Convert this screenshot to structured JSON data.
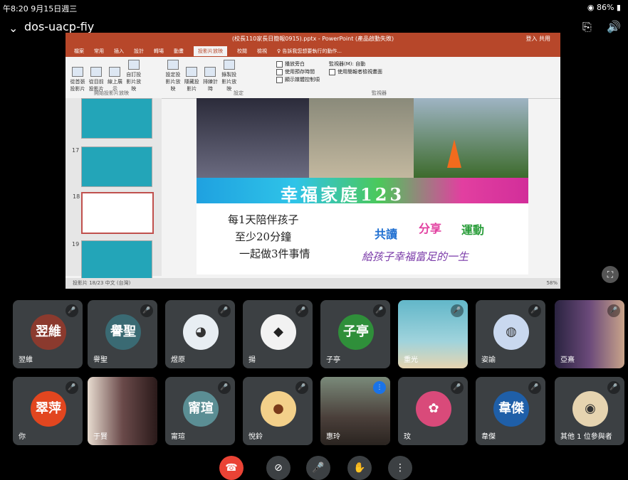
{
  "status": {
    "time": "午8:20  9月15日週三",
    "battery": "86%"
  },
  "meeting": {
    "code": "dos-uacp-fiy",
    "chevron": "chevron-down-icon"
  },
  "ppt": {
    "window_title": "(校長110家長日簡報0915).pptx - PowerPoint (產品啟動失敗)",
    "tabs": [
      "檔案",
      "常用",
      "插入",
      "設計",
      "轉場",
      "動畫",
      "投影片放映",
      "校閱",
      "檢視",
      "♀ 告訴我您想要執行的動作..."
    ],
    "active_tab": "投影片放映",
    "buttons": [
      "從首張投影片",
      "從目前投影片",
      "線上展示",
      "自訂投影片放映",
      "設定投影片放映",
      "隱藏投影片",
      "排練計時",
      "錄製投影片放映"
    ],
    "groups": [
      "開始投影片放映",
      "設定",
      "監視器"
    ],
    "checks": [
      "播放旁白",
      "使用預存時間",
      "顯示媒體控制項",
      "使用簡報者檢視畫面"
    ],
    "monitor": "監視器(M): 自動",
    "signin": "登入  共用",
    "slide_numbers": [
      "17",
      "18",
      "19"
    ],
    "slide_status": "投影片 18/23    中文 (台灣)",
    "zoom": "58%"
  },
  "slide": {
    "banner": "幸福家庭123",
    "lines": [
      "每1天陪伴孩子",
      "至少20分鐘",
      "一起做3件事情"
    ],
    "tags": [
      "共讀",
      "分享",
      "運動"
    ],
    "tagline": "給孩子幸福富足的一生"
  },
  "participants": [
    {
      "name": "翌維",
      "avatar": "翌維",
      "color": "#8b3a2e"
    },
    {
      "name": "譽聖",
      "avatar": "譽聖",
      "color": "#3a6a73"
    },
    {
      "name": "煜原",
      "avatar": "",
      "color": "#e8eef3"
    },
    {
      "name": "揚",
      "avatar": "",
      "color": "#f2f2f2"
    },
    {
      "name": "子亭",
      "avatar": "子亭",
      "color": "#2f8f3a"
    },
    {
      "name": "重光",
      "avatar": "",
      "color": "#62b7c9"
    },
    {
      "name": "姿諭",
      "avatar": "",
      "color": "#c9d8ef"
    },
    {
      "name": "亞熹",
      "avatar": "",
      "color": "#5a4a70"
    },
    {
      "name": "你",
      "avatar": "翠萍",
      "color": "#e2461f"
    },
    {
      "name": "于賢",
      "avatar": "",
      "color": "#6a4a4a"
    },
    {
      "name": "甯瑄",
      "avatar": "甯瑄",
      "color": "#5b8e94"
    },
    {
      "name": "悅鈴",
      "avatar": "",
      "color": "#f3d08a"
    },
    {
      "name": "惠玲",
      "avatar": "",
      "color": "#4a3f3a"
    },
    {
      "name": "玟",
      "avatar": "",
      "color": "#d94a7a"
    },
    {
      "name": "韋傑",
      "avatar": "韋傑",
      "color": "#1f5fa8"
    },
    {
      "name": "其他 1 位參與者",
      "avatar": "",
      "color": "#3c4043"
    }
  ]
}
